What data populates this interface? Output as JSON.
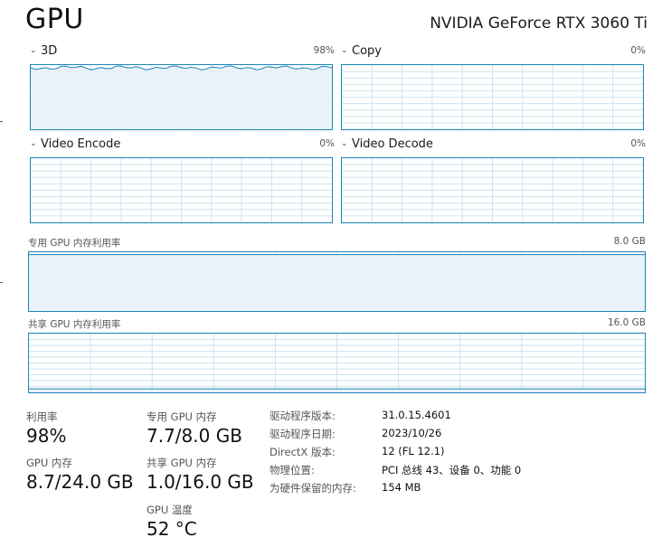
{
  "header": {
    "title": "GPU",
    "gpu_name": "NVIDIA GeForce RTX 3060 Ti"
  },
  "engines": [
    {
      "name": "3D",
      "percent": "98%",
      "usage": 0.98
    },
    {
      "name": "Copy",
      "percent": "0%",
      "usage": 0
    },
    {
      "name": "Video Encode",
      "percent": "0%",
      "usage": 0
    },
    {
      "name": "Video Decode",
      "percent": "0%",
      "usage": 0
    }
  ],
  "dedicated_memory_graph": {
    "label": "专用 GPU 内存利用率",
    "max": "8.0 GB",
    "usage": 0.96
  },
  "shared_memory_graph": {
    "label": "共享 GPU 内存利用率",
    "max": "16.0 GB",
    "usage": 0.06
  },
  "stats": {
    "utilization": {
      "label": "利用率",
      "value": "98%"
    },
    "dedicated_memory": {
      "label": "专用 GPU 内存",
      "value": "7.7/8.0 GB"
    },
    "gpu_memory": {
      "label": "GPU 内存",
      "value": "8.7/24.0 GB"
    },
    "shared_memory": {
      "label": "共享 GPU 内存",
      "value": "1.0/16.0 GB"
    },
    "temperature": {
      "label": "GPU 温度",
      "value": "52 °C"
    }
  },
  "driver_info": [
    {
      "key": "驱动程序版本:",
      "value": "31.0.15.4601"
    },
    {
      "key": "驱动程序日期:",
      "value": "2023/10/26"
    },
    {
      "key": "DirectX 版本:",
      "value": "12 (FL 12.1)"
    },
    {
      "key": "物理位置:",
      "value": "PCI 总线 43、设备 0、功能 0"
    },
    {
      "key": "为硬件保留的内存:",
      "value": "154 MB"
    }
  ],
  "theme": {
    "line": "#1985b5",
    "fill": "#e6f1f8",
    "grid": "#cde3ef"
  }
}
